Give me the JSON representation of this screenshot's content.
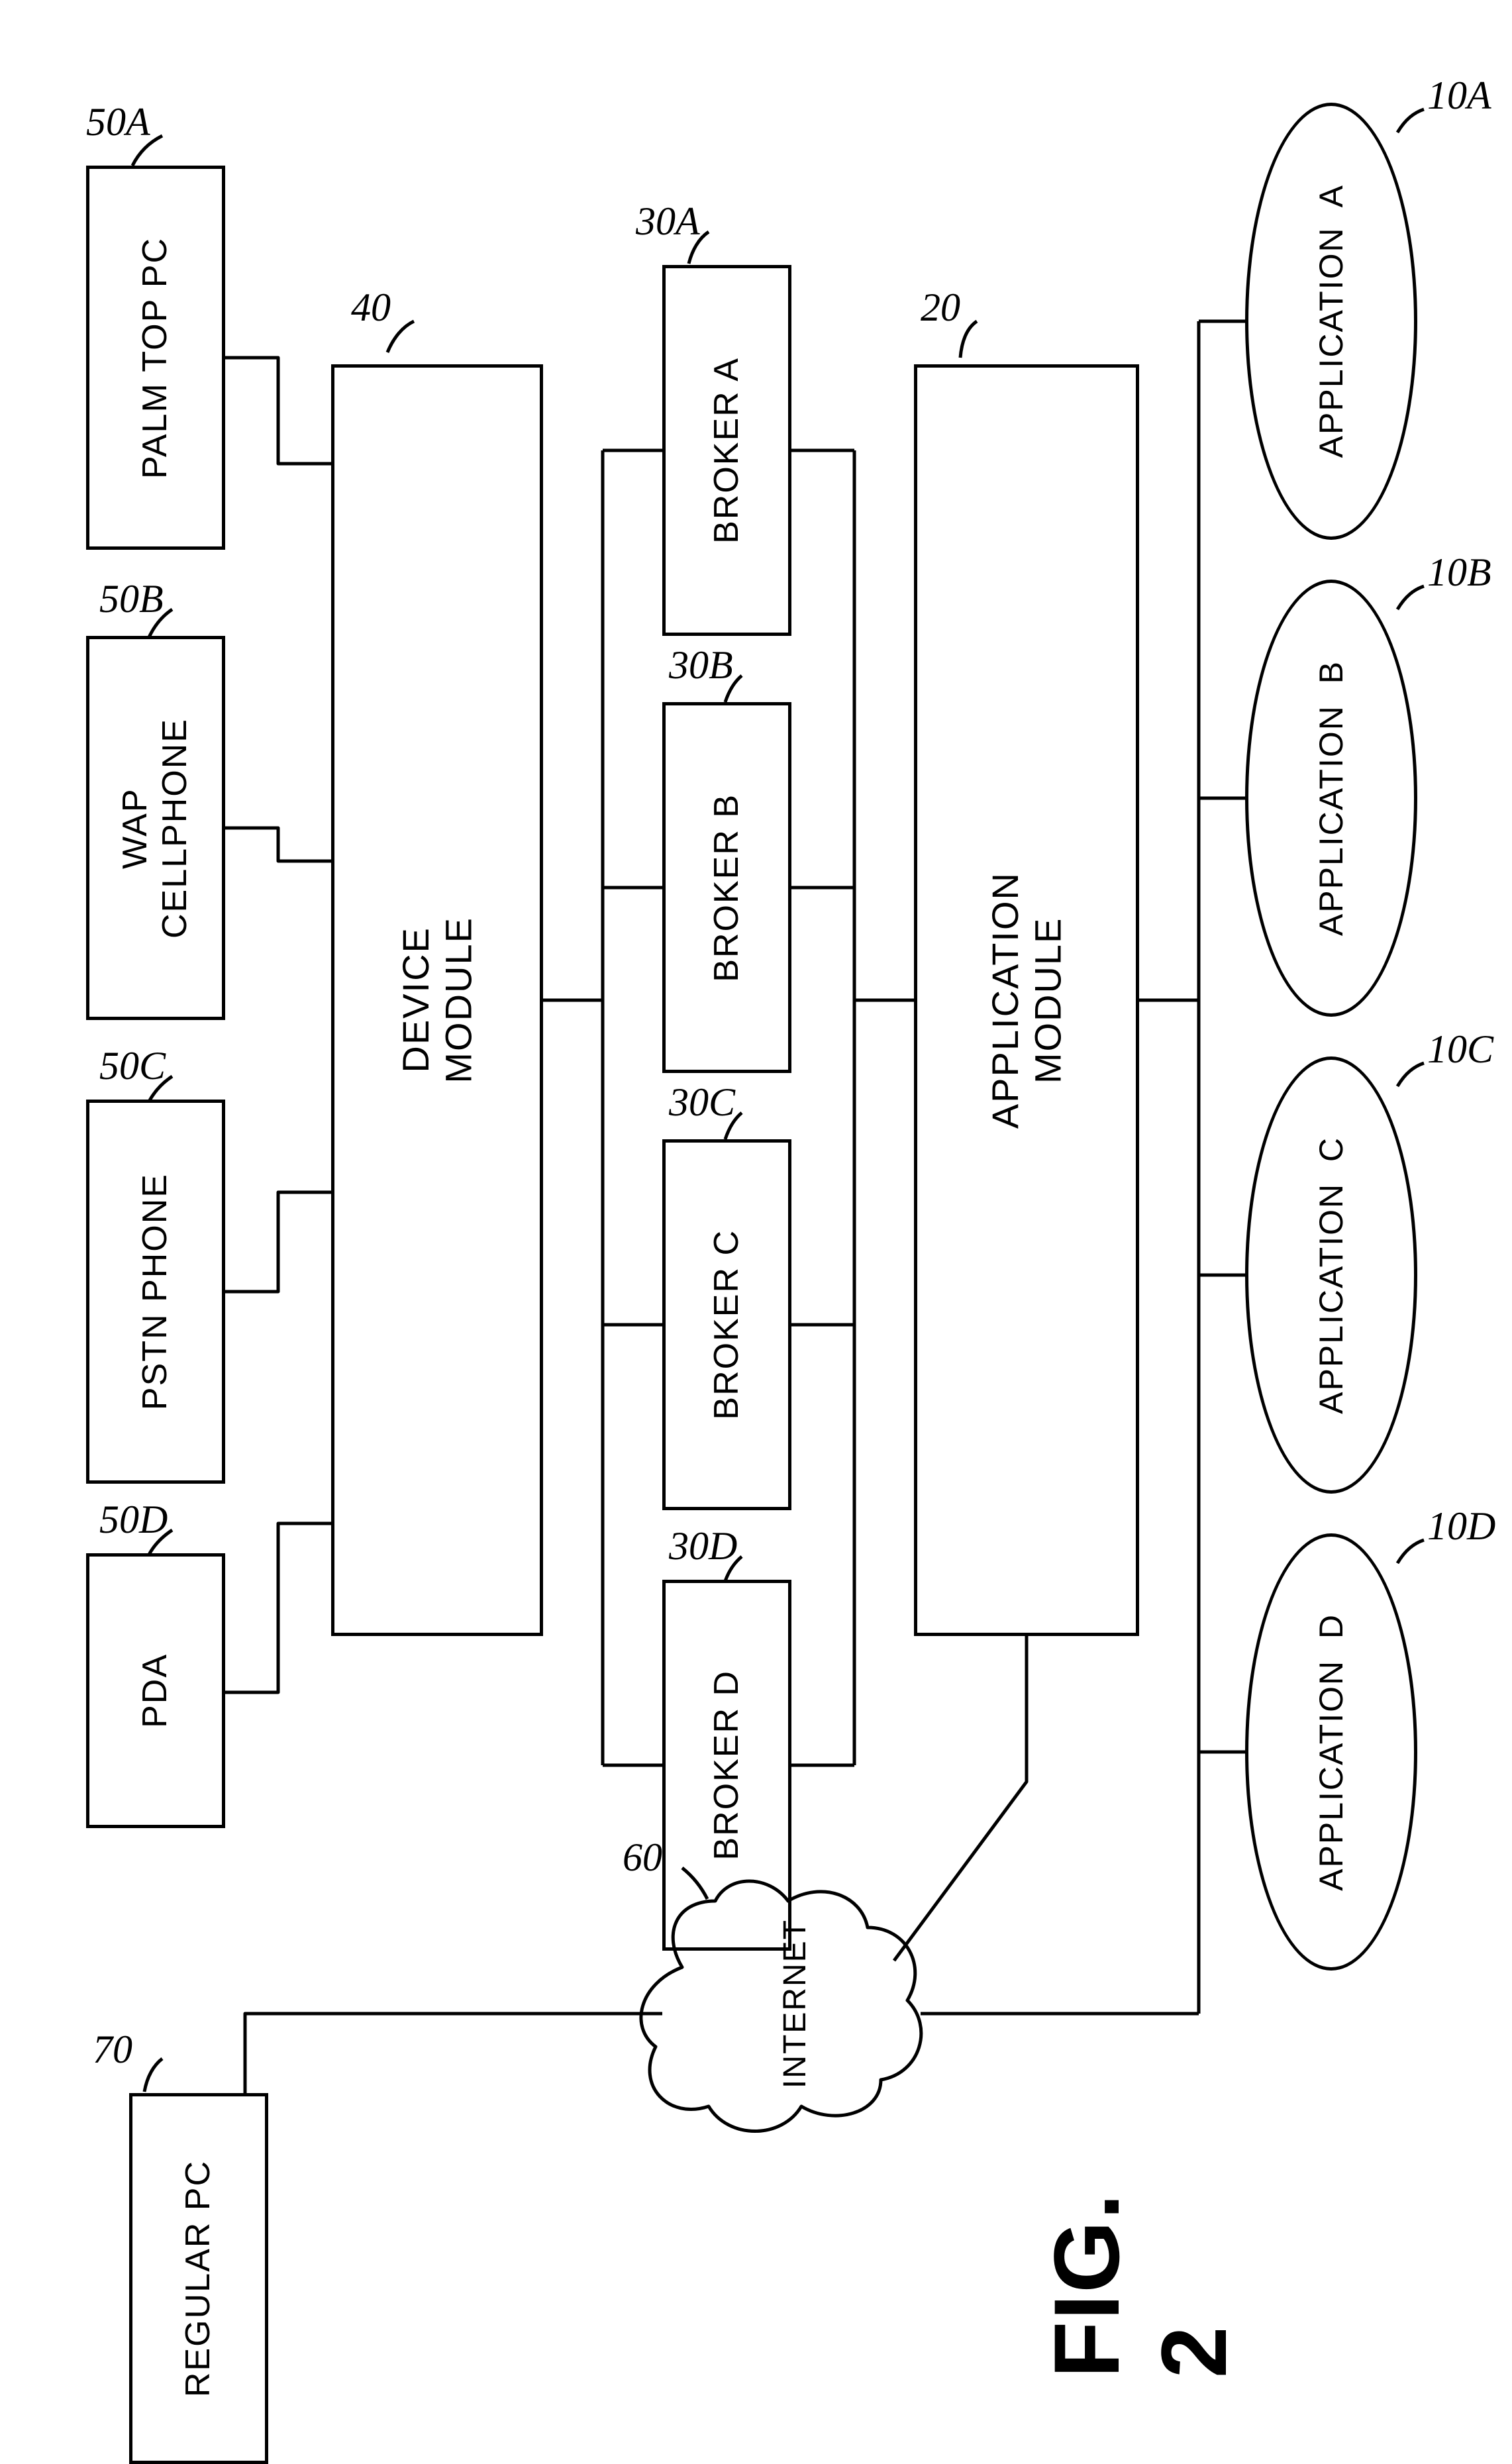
{
  "figure_label": "FIG. 2",
  "devices": [
    {
      "ref": "50A",
      "label": "PALM TOP PC"
    },
    {
      "ref": "50B",
      "label": "WAP\nCELLPHONE"
    },
    {
      "ref": "50C",
      "label": "PSTN PHONE"
    },
    {
      "ref": "50D",
      "label": "PDA"
    }
  ],
  "device_module": {
    "ref": "40",
    "label": "DEVICE\nMODULE"
  },
  "brokers": [
    {
      "ref": "30A",
      "label": "BROKER A"
    },
    {
      "ref": "30B",
      "label": "BROKER B"
    },
    {
      "ref": "30C",
      "label": "BROKER C"
    },
    {
      "ref": "30D",
      "label": "BROKER D"
    }
  ],
  "application_module": {
    "ref": "20",
    "label": "APPLICATION\nMODULE"
  },
  "applications": [
    {
      "ref": "10A",
      "label": "APPLICATION  A"
    },
    {
      "ref": "10B",
      "label": "APPLICATION  B"
    },
    {
      "ref": "10C",
      "label": "APPLICATION  C"
    },
    {
      "ref": "10D",
      "label": "APPLICATION  D"
    }
  ],
  "internet": {
    "ref": "60",
    "label": "INTERNET"
  },
  "regular_pc": {
    "ref": "70",
    "label": "REGULAR PC"
  }
}
